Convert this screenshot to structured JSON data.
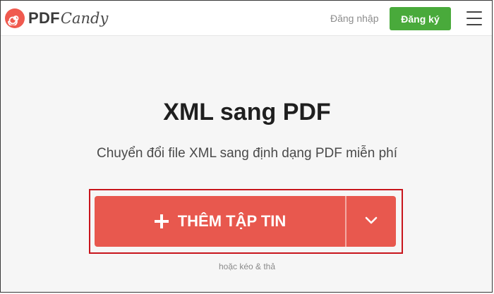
{
  "header": {
    "logo_pdf": "PDF",
    "logo_candy": "Candy",
    "login_label": "Đăng nhập",
    "signup_label": "Đăng ký"
  },
  "main": {
    "title": "XML sang PDF",
    "subtitle": "Chuyển đổi file XML sang định dạng PDF miễn phí",
    "add_file_label": "THÊM TẬP TIN",
    "drag_hint": "hoặc kéo & thả"
  },
  "icons": {
    "logo": "pdfcandy-swirl-icon",
    "menu": "hamburger-menu-icon",
    "add": "plus-icon",
    "dropdown": "chevron-down-icon"
  },
  "colors": {
    "brand_red": "#e8584e",
    "signup_green": "#49aa3b",
    "highlight_outline": "#c8151c"
  }
}
